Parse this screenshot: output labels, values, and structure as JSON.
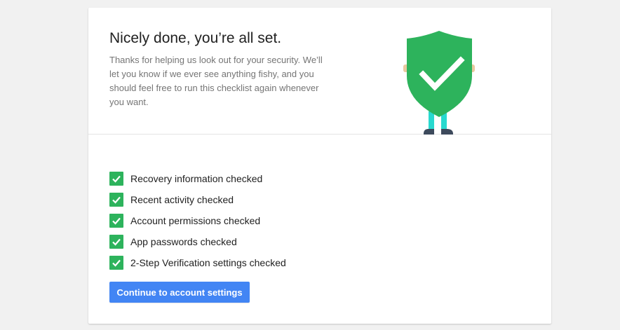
{
  "header": {
    "title": "Nicely done, you’re all set.",
    "description": "Thanks for helping us look out for your security. We’ll let you know if we ever see anything fishy, and you should feel free to run this checklist again whenever you want."
  },
  "illustration": {
    "icon": "shield-check-icon",
    "shield_color": "#2db35c",
    "legs_color": "#28d9cf",
    "shoes_color": "#3d4a5c"
  },
  "checklist": {
    "items": [
      {
        "label": "Recovery information checked",
        "checked": true
      },
      {
        "label": "Recent activity checked",
        "checked": true
      },
      {
        "label": "Account permissions checked",
        "checked": true
      },
      {
        "label": "App passwords checked",
        "checked": true
      },
      {
        "label": "2-Step Verification settings checked",
        "checked": true
      }
    ],
    "check_color": "#2db35c"
  },
  "actions": {
    "continue_label": "Continue to account settings",
    "button_color": "#4285f4"
  }
}
